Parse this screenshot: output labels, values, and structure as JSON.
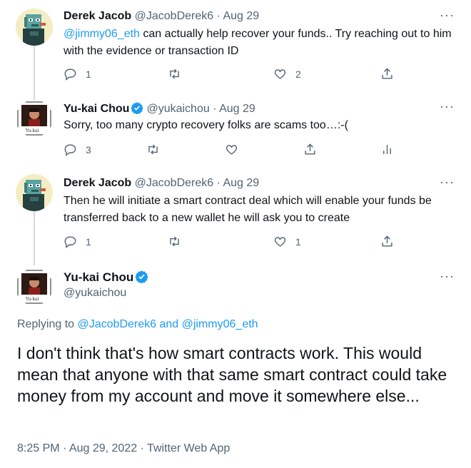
{
  "replies": [
    {
      "name": "Derek Jacob",
      "handle": "@JacobDerek6",
      "separator": "·",
      "date": "Aug 29",
      "mention": "@jimmy06_eth",
      "text": " can actually help recover your funds.. Try reaching out to him with the evidence or transaction ID",
      "reply_count": "1",
      "retweet_count": "",
      "like_count": "2"
    },
    {
      "name": "Yu-kai Chou",
      "handle": "@yukaichou",
      "separator": "·",
      "date": "Aug 29",
      "text": "Sorry, too many crypto recovery folks are scams too…:-(",
      "reply_count": "3",
      "retweet_count": "",
      "like_count": ""
    },
    {
      "name": "Derek Jacob",
      "handle": "@JacobDerek6",
      "separator": "·",
      "date": "Aug 29",
      "text": "Then he will initiate a smart contract deal which will enable your funds be transferred back to a new wallet he will ask you to create",
      "reply_count": "1",
      "retweet_count": "",
      "like_count": "1"
    }
  ],
  "main_tweet": {
    "name": "Yu-kai Chou",
    "handle": "@yukaichou",
    "replying_label": "Replying to",
    "reply_user_1": "@JacobDerek6",
    "reply_and": "and",
    "reply_user_2": "@jimmy06_eth",
    "text": "I don't think that's how smart contracts work. This would mean that anyone with that same smart contract could take money from my account and move it somewhere else...",
    "timestamp": "8:25 PM · Aug 29, 2022 · Twitter Web App"
  },
  "avatar_badge_text": "Yu-kai",
  "more_glyph": "···",
  "colors": {
    "accent": "#1d9bf0",
    "muted": "#536471",
    "text": "#0f1419",
    "thread_line": "#cfd9de"
  },
  "icons": [
    "reply-icon",
    "retweet-icon",
    "like-icon",
    "share-icon",
    "analytics-icon",
    "verified-badge-icon",
    "more-icon"
  ]
}
